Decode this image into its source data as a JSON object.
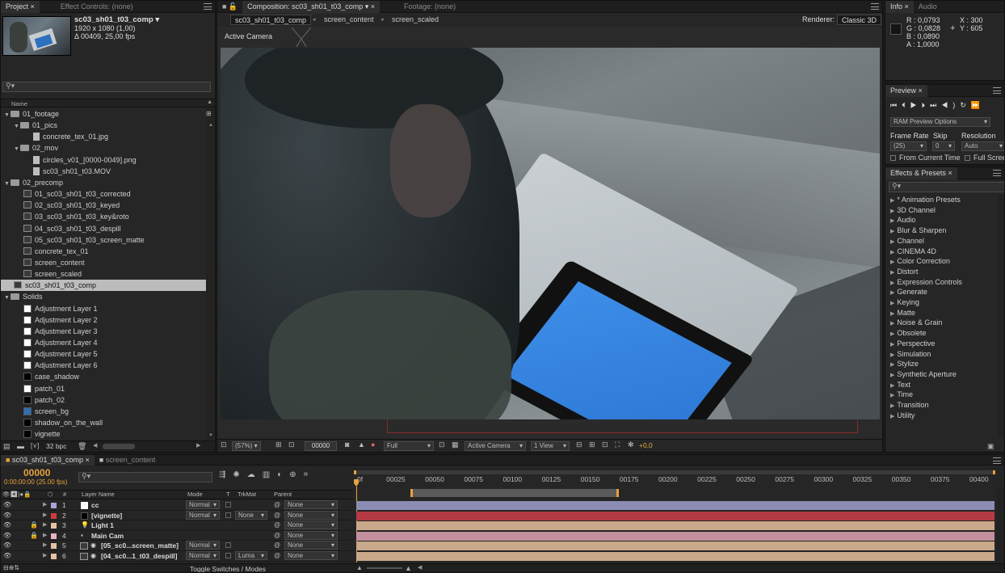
{
  "project": {
    "tabs": [
      "Project",
      "Effect Controls: (none)"
    ],
    "comp_name": "sc03_sh01_t03_comp ▾",
    "comp_res": "1920 x 1080 (1,00)",
    "comp_dur": "Δ 00409, 25,00 fps",
    "search_placeholder": "",
    "col_name": "Name",
    "bpc": "32 bpc",
    "items": [
      {
        "label": "01_footage",
        "type": "folder",
        "indent": 0,
        "open": true
      },
      {
        "label": "01_pics",
        "type": "folder",
        "indent": 1,
        "open": true
      },
      {
        "label": "concrete_tex_01.jpg",
        "type": "file",
        "indent": 3
      },
      {
        "label": "02_mov",
        "type": "folder",
        "indent": 1,
        "open": true
      },
      {
        "label": "circles_v01_[0000-0049].png",
        "type": "file",
        "indent": 3
      },
      {
        "label": "sc03_sh01_t03.MOV",
        "type": "file",
        "indent": 3
      },
      {
        "label": "02_precomp",
        "type": "folder",
        "indent": 0,
        "open": true
      },
      {
        "label": "01_sc03_sh01_t03_corrected",
        "type": "comp",
        "indent": 2
      },
      {
        "label": "02_sc03_sh01_t03_keyed",
        "type": "comp",
        "indent": 2
      },
      {
        "label": "03_sc03_sh01_t03_key&roto",
        "type": "comp",
        "indent": 2
      },
      {
        "label": "04_sc03_sh01_t03_despill",
        "type": "comp",
        "indent": 2
      },
      {
        "label": "05_sc03_sh01_t03_screen_matte",
        "type": "comp",
        "indent": 2
      },
      {
        "label": "concrete_tex_01",
        "type": "comp",
        "indent": 2
      },
      {
        "label": "screen_content",
        "type": "comp",
        "indent": 2
      },
      {
        "label": "screen_scaled",
        "type": "comp",
        "indent": 2
      },
      {
        "label": "sc03_sh01_t03_comp",
        "type": "comp",
        "indent": 1,
        "selected": true
      },
      {
        "label": "Solids",
        "type": "folder",
        "indent": 0,
        "open": true
      },
      {
        "label": "Adjustment Layer 1",
        "type": "solid",
        "color": "#ffffff",
        "indent": 2
      },
      {
        "label": "Adjustment Layer 2",
        "type": "solid",
        "color": "#ffffff",
        "indent": 2
      },
      {
        "label": "Adjustment Layer 3",
        "type": "solid",
        "color": "#ffffff",
        "indent": 2
      },
      {
        "label": "Adjustment Layer 4",
        "type": "solid",
        "color": "#ffffff",
        "indent": 2
      },
      {
        "label": "Adjustment Layer 5",
        "type": "solid",
        "color": "#ffffff",
        "indent": 2
      },
      {
        "label": "Adjustment Layer 6",
        "type": "solid",
        "color": "#ffffff",
        "indent": 2
      },
      {
        "label": "case_shadow",
        "type": "solid",
        "color": "#000000",
        "indent": 2
      },
      {
        "label": "patch_01",
        "type": "solid",
        "color": "#ffffff",
        "indent": 2
      },
      {
        "label": "patch_02",
        "type": "solid",
        "color": "#000000",
        "indent": 2
      },
      {
        "label": "screen_bg",
        "type": "solid",
        "color": "#2d6fb5",
        "indent": 2
      },
      {
        "label": "shadow_on_the_wall",
        "type": "solid",
        "color": "#000000",
        "indent": 2
      },
      {
        "label": "vignette",
        "type": "solid",
        "color": "#000000",
        "indent": 2
      }
    ]
  },
  "composition": {
    "tab_label": "Composition: sc03_sh01_t03_comp",
    "footage_tab": "Footage: (none)",
    "breadcrumbs": [
      "sc03_sh01_t03_comp",
      "screen_content",
      "screen_scaled"
    ],
    "renderer_label": "Renderer:",
    "renderer_value": "Classic 3D",
    "view_label": "Active Camera",
    "footer": {
      "zoom": "(57%)",
      "timecode": "00000",
      "resolution": "Full",
      "camera": "Active Camera",
      "views": "1 View",
      "exposure": "+0,0"
    }
  },
  "info": {
    "tabs": [
      "Info",
      "Audio"
    ],
    "r": "R : 0,0793",
    "g": "G : 0,0828",
    "b": "B : 0,0890",
    "a": "A : 1,0000",
    "x": "X : 300",
    "y": "Y : 605"
  },
  "preview": {
    "tab": "Preview",
    "ram_options": "RAM Preview Options",
    "frame_rate_label": "Frame Rate",
    "skip_label": "Skip",
    "resolution_label": "Resolution",
    "frame_rate": "(25)",
    "skip": "0",
    "resolution": "Auto",
    "from_current": "From Current Time",
    "full_screen": "Full Screen"
  },
  "effects": {
    "tab": "Effects & Presets",
    "items": [
      "* Animation Presets",
      "3D Channel",
      "Audio",
      "Blur & Sharpen",
      "Channel",
      "CINEMA 4D",
      "Color Correction",
      "Distort",
      "Expression Controls",
      "Generate",
      "Keying",
      "Matte",
      "Noise & Grain",
      "Obsolete",
      "Perspective",
      "Simulation",
      "Stylize",
      "Synthetic Aperture",
      "Text",
      "Time",
      "Transition",
      "Utility"
    ]
  },
  "timeline": {
    "tabs": [
      "sc03_sh01_t03_comp",
      "screen_content"
    ],
    "timecode": "00000",
    "timecode_sub": "0:00:00:00 (25.00 fps)",
    "columns": {
      "num": "#",
      "layer_name": "Layer Name",
      "mode": "Mode",
      "t": "T",
      "trkmat": "TrkMat",
      "parent": "Parent"
    },
    "ticks": [
      "0f",
      "00025",
      "00050",
      "00075",
      "00100",
      "00125",
      "00150",
      "00175",
      "00200",
      "00225",
      "00250",
      "00275",
      "00300",
      "00325",
      "00350",
      "00375",
      "00400"
    ],
    "layers": [
      {
        "num": "1",
        "name": "cc",
        "label_color": "#a8a4d6",
        "icon": "white",
        "mode": "Normal",
        "trkmat": "",
        "parent": "None",
        "bar": "#8c8cb4"
      },
      {
        "num": "2",
        "name": "[vignette]",
        "label_color": "#d23a3a",
        "icon": "black",
        "mode": "Normal",
        "trkmat": "None",
        "parent": "None",
        "bar": "#b43a44"
      },
      {
        "num": "3",
        "name": "Light 1",
        "label_color": "#e4c3a3",
        "icon": "light",
        "mode": "",
        "trkmat": "",
        "parent": "None",
        "bar": "#c9a98a"
      },
      {
        "num": "4",
        "name": "Main Cam",
        "label_color": "#e8b4c4",
        "icon": "camera",
        "mode": "",
        "trkmat": "",
        "parent": "None",
        "bar": "#c4909e"
      },
      {
        "num": "5",
        "name": "[05_sc0...screen_matte]",
        "label_color": "#e4c3a3",
        "icon": "comp",
        "mode": "Normal",
        "trkmat": "",
        "parent": "None",
        "bar": "#c9a98a"
      },
      {
        "num": "6",
        "name": "[04_sc0...1_t03_despill]",
        "label_color": "#e4c3a3",
        "icon": "comp",
        "mode": "Normal",
        "trkmat": "Luma",
        "parent": "None",
        "bar": "#c9a98a"
      }
    ],
    "toggle_label": "Toggle Switches / Modes"
  }
}
